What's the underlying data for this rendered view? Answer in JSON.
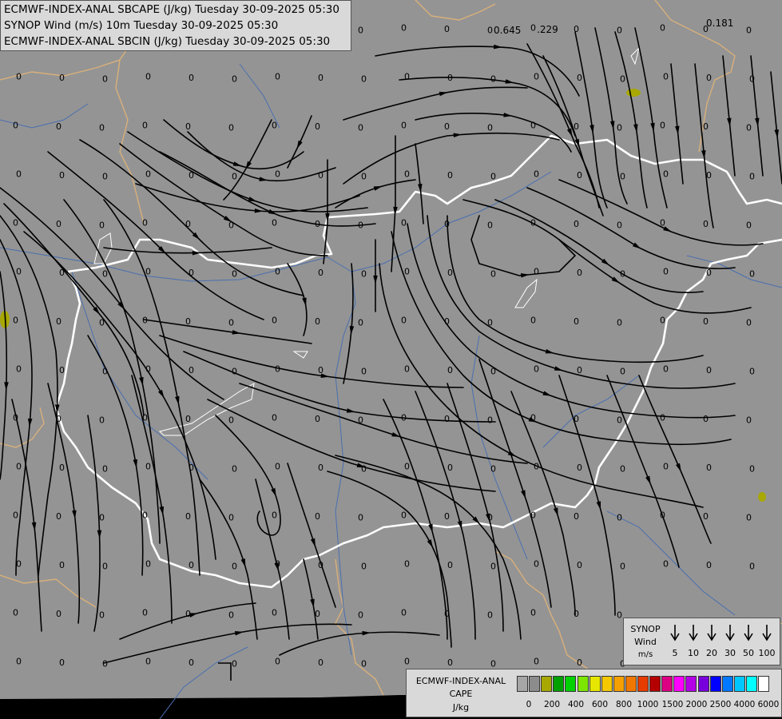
{
  "titles": [
    "ECMWF-INDEX-ANAL SBCAPE (J/kg) Tuesday 30-09-2025 05:30",
    "SYNOP Wind (m/s) 10m Tuesday 30-09-2025 05:30",
    "ECMWF-INDEX-ANAL SBCIN (J/kg) Tuesday 30-09-2025 05:30"
  ],
  "map": {
    "background_color": "#949494",
    "streamline_color": "#000000",
    "border_color": "#ffffff",
    "region_border_color": "#d9b07a",
    "river_color": "#4a6fb0",
    "value_labels_highlight": [
      "0.645",
      ".229",
      "0.181"
    ]
  },
  "wind_legend": {
    "title_lines": [
      "SYNOP",
      "Wind",
      "m/s"
    ],
    "speeds": [
      "5",
      "10",
      "20",
      "30",
      "50",
      "100"
    ]
  },
  "cape_legend": {
    "title_lines": [
      "ECMWF-INDEX-ANAL",
      "CAPE",
      "J/kg"
    ],
    "colors": [
      "#a6a6a6",
      "#8c8c8c",
      "#a8a800",
      "#00a000",
      "#00d200",
      "#7de600",
      "#e6e600",
      "#f5c800",
      "#f5a000",
      "#f07800",
      "#e63c00",
      "#b40000",
      "#dc0082",
      "#ff00ff",
      "#b400e6",
      "#7800dc",
      "#0000ff",
      "#0078ff",
      "#00c8ff",
      "#00ffff",
      "#ffffff"
    ],
    "labels": [
      "0",
      "200",
      "400",
      "600",
      "800",
      "1000",
      "1500",
      "2000",
      "2500",
      "4000",
      "6000"
    ]
  }
}
